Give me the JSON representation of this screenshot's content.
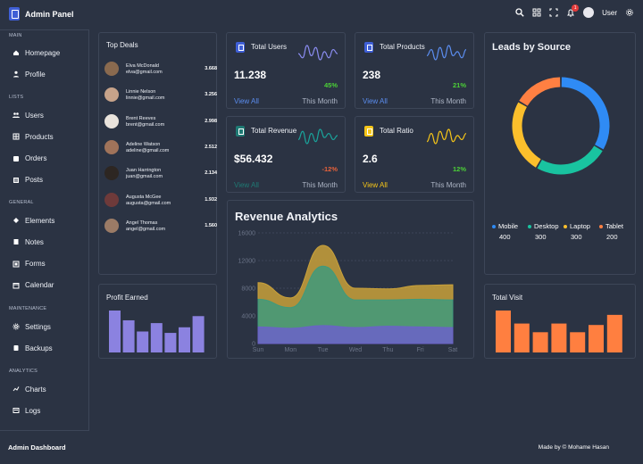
{
  "app": {
    "title": "Admin Panel"
  },
  "topbar": {
    "user_label": "User",
    "notification_count": "1",
    "icons": [
      "search-icon",
      "grid-icon",
      "fullscreen-icon",
      "bell-icon",
      "settings-icon"
    ]
  },
  "sidebar": {
    "sections": [
      {
        "label": "MAIN",
        "items": [
          {
            "label": "Homepage",
            "icon": "home-icon"
          },
          {
            "label": "Profile",
            "icon": "person-icon"
          }
        ]
      },
      {
        "label": "LISTS",
        "items": [
          {
            "label": "Users",
            "icon": "users-icon"
          },
          {
            "label": "Products",
            "icon": "products-icon"
          },
          {
            "label": "Orders",
            "icon": "orders-icon"
          },
          {
            "label": "Posts",
            "icon": "posts-icon"
          }
        ]
      },
      {
        "label": "GENERAL",
        "items": [
          {
            "label": "Elements",
            "icon": "elements-icon"
          },
          {
            "label": "Notes",
            "icon": "notes-icon"
          },
          {
            "label": "Forms",
            "icon": "forms-icon"
          },
          {
            "label": "Calendar",
            "icon": "calendar-icon"
          }
        ]
      },
      {
        "label": "MAINTENANCE",
        "items": [
          {
            "label": "Settings",
            "icon": "settings-icon"
          },
          {
            "label": "Backups",
            "icon": "backups-icon"
          }
        ]
      },
      {
        "label": "ANALYTICS",
        "items": [
          {
            "label": "Charts",
            "icon": "charts-icon"
          },
          {
            "label": "Logs",
            "icon": "logs-icon"
          }
        ]
      }
    ]
  },
  "top_deals": {
    "title": "Top Deals",
    "deals": [
      {
        "name": "Elva McDonald",
        "email": "elva@gmail.com",
        "value": "3.668",
        "avatar_color": "#8a6a4f"
      },
      {
        "name": "Linnie Nelson",
        "email": "linnie@gmail.com",
        "value": "3.256",
        "avatar_color": "#c7a38a"
      },
      {
        "name": "Brent Reeves",
        "email": "brent@gmail.com",
        "value": "2.998",
        "avatar_color": "#e9e3dc"
      },
      {
        "name": "Adeline Watson",
        "email": "adeline@gmail.com",
        "value": "2.512",
        "avatar_color": "#a0735a"
      },
      {
        "name": "Juan Harrington",
        "email": "juan@gmail.com",
        "value": "2.134",
        "avatar_color": "#2d2622"
      },
      {
        "name": "Augusta McGee",
        "email": "augusta@gmail.com",
        "value": "1.932",
        "avatar_color": "#6e3a3a"
      },
      {
        "name": "Angel Thomas",
        "email": "angel@gmail.com",
        "value": "1.560",
        "avatar_color": "#9b7b66"
      }
    ]
  },
  "stats": [
    {
      "name": "Total Users",
      "value": "11.238",
      "percent": "45%",
      "percent_color": "#4cd137",
      "link": "View All",
      "link_color": "#5b8def",
      "period": "This Month",
      "icon_color": "#3f5fd6",
      "spark_color": "#8a8cf0",
      "spark": [
        6,
        4,
        10,
        5,
        9,
        3,
        7,
        4,
        8,
        6
      ]
    },
    {
      "name": "Total Products",
      "value": "238",
      "percent": "21%",
      "percent_color": "#4cd137",
      "link": "View All",
      "link_color": "#5b8def",
      "period": "This Month",
      "icon_color": "#3f5fd6",
      "spark_color": "#5b8def",
      "spark": [
        5,
        8,
        3,
        9,
        4,
        10,
        5,
        7,
        4,
        8
      ]
    },
    {
      "name": "Total Revenue",
      "value": "$56.432",
      "percent": "-12%",
      "percent_color": "#e8623b",
      "link": "View All",
      "link_color": "#1f7a74",
      "period": "This Month",
      "icon_color": "#1f7a74",
      "spark_color": "#1aa39b",
      "spark": [
        5,
        9,
        3,
        8,
        4,
        10,
        6,
        8,
        5,
        7
      ]
    },
    {
      "name": "Total Ratio",
      "value": "2.6",
      "percent": "12%",
      "percent_color": "#4cd137",
      "link": "View All",
      "link_color": "#f5c518",
      "period": "This Month",
      "icon_color": "#f5c518",
      "spark_color": "#f5c518",
      "spark": [
        4,
        8,
        3,
        9,
        5,
        10,
        4,
        7,
        5,
        8
      ]
    }
  ],
  "leads": {
    "title": "Leads by Source",
    "items": [
      {
        "name": "Mobile",
        "value": 400,
        "color": "#2f8bf5"
      },
      {
        "name": "Desktop",
        "value": 300,
        "color": "#19c3a0"
      },
      {
        "name": "Laptop",
        "value": 300,
        "color": "#fbbf2c"
      },
      {
        "name": "Tablet",
        "value": 200,
        "color": "#ff8042"
      }
    ]
  },
  "revenue": {
    "title": "Revenue Analytics"
  },
  "chart_data": [
    {
      "type": "area",
      "title": "Revenue Analytics",
      "categories": [
        "Sun",
        "Mon",
        "Tue",
        "Wed",
        "Thu",
        "Fri",
        "Sat"
      ],
      "ylim": [
        0,
        16000
      ],
      "yticks": [
        0,
        4000,
        8000,
        12000,
        16000
      ],
      "stacked": true,
      "series": [
        {
          "color": "#6b62c9",
          "values": [
            2400,
            2200,
            2600,
            2300,
            2500,
            2400,
            2300
          ]
        },
        {
          "color": "#3f9a7c",
          "values": [
            4000,
            3000,
            8600,
            4000,
            3800,
            4000,
            4000
          ]
        },
        {
          "color": "#c9a13a",
          "values": [
            2400,
            1400,
            3000,
            1700,
            1600,
            2000,
            2200
          ]
        }
      ]
    },
    {
      "type": "bar",
      "title": "Profit Earned",
      "values": [
        60,
        46,
        30,
        42,
        28,
        36,
        52
      ],
      "color": "#8b82e0"
    },
    {
      "type": "bar",
      "title": "Total Visit",
      "values": [
        58,
        40,
        28,
        40,
        28,
        38,
        52
      ],
      "color": "#ff7f40"
    },
    {
      "type": "pie",
      "title": "Leads by Source",
      "categories": [
        "Mobile",
        "Desktop",
        "Laptop",
        "Tablet"
      ],
      "values": [
        400,
        300,
        300,
        200
      ]
    }
  ],
  "profit": {
    "title": "Profit Earned"
  },
  "visits": {
    "title": "Total Visit"
  },
  "footer": {
    "left": "Admin Dashboard",
    "right": "Made by © Mohame Hasan"
  }
}
